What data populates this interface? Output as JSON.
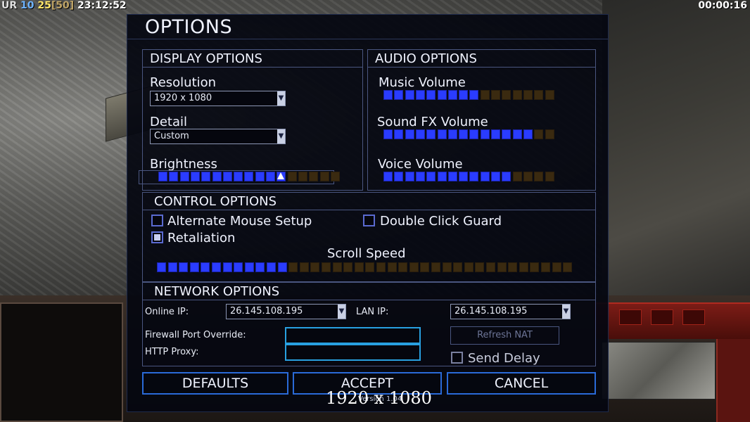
{
  "hud": {
    "faction": "UR",
    "count_a": "10",
    "count_b": "25",
    "count_c": "[50]",
    "clock": "23:12:52",
    "timer": "00:00:16"
  },
  "options": {
    "title": "OPTIONS",
    "display": {
      "heading": "DISPLAY OPTIONS",
      "resolution_label": "Resolution",
      "resolution_value": "1920 x 1080",
      "detail_label": "Detail",
      "detail_value": "Custom",
      "brightness_label": "Brightness",
      "brightness_level": {
        "filled": 12,
        "total": 17
      }
    },
    "audio": {
      "heading": "AUDIO OPTIONS",
      "music_label": "Music Volume",
      "music_level": {
        "filled": 9,
        "total": 16
      },
      "sfx_label": "Sound FX Volume",
      "sfx_level": {
        "filled": 14,
        "total": 16
      },
      "voice_label": "Voice Volume",
      "voice_level": {
        "filled": 12,
        "total": 16
      }
    },
    "control": {
      "heading": "CONTROL OPTIONS",
      "alt_mouse_label": "Alternate Mouse Setup",
      "alt_mouse_checked": false,
      "double_click_label": "Double Click Guard",
      "double_click_checked": false,
      "retaliation_label": "Retaliation",
      "retaliation_checked": true,
      "scroll_label": "Scroll Speed",
      "scroll_level": {
        "filled": 12,
        "total": 38
      }
    },
    "network": {
      "heading": "NETWORK OPTIONS",
      "online_ip_label": "Online IP:",
      "online_ip_value": "26.145.108.195",
      "lan_ip_label": "LAN IP:",
      "lan_ip_value": "26.145.108.195",
      "firewall_label": "Firewall Port Override:",
      "firewall_value": "",
      "proxy_label": "HTTP Proxy:",
      "proxy_value": "",
      "refresh_nat_label": "Refresh NAT",
      "send_delay_label": "Send Delay",
      "send_delay_checked": false
    },
    "buttons": {
      "defaults": "DEFAULTS",
      "accept": "ACCEPT",
      "cancel": "CANCEL"
    },
    "version": "Version 1.04"
  },
  "overlay_resolution": "1920 x 1080",
  "colors": {
    "slider_on": "#2a3cff",
    "slider_off": "#3a2a10",
    "panel_border": "#4a5680",
    "button_border": "#2a6ad8",
    "field_border": "#28a0e0"
  }
}
